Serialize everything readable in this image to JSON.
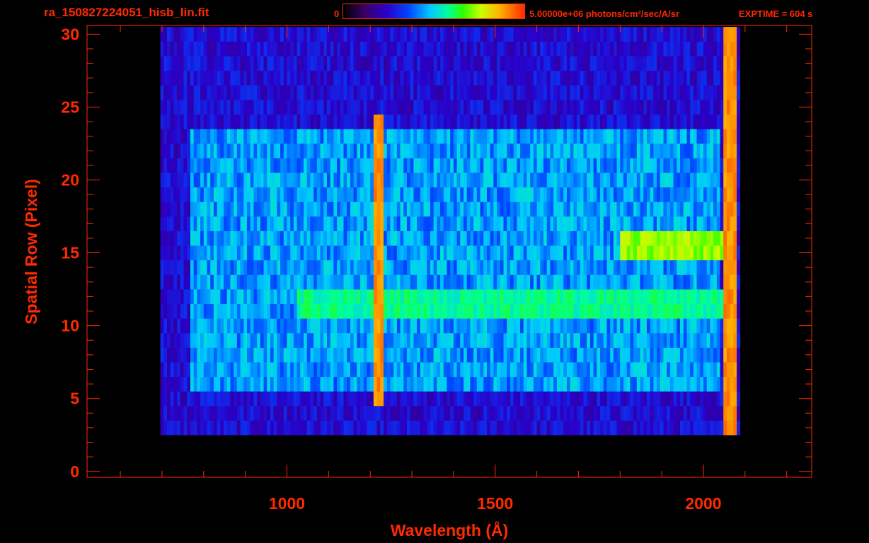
{
  "header": {
    "file_title": "ra_150827224051_hisb_lin.fit",
    "colorbar_min": "0",
    "colorbar_max": "5.00000e+06 photons/cm²/sec/A/sr",
    "exptime": "EXPTIME = 604 s"
  },
  "colors": {
    "axis": "#ff2a00",
    "background": "#000000",
    "colormap": [
      "#000000",
      "#3a0066",
      "#2a00c8",
      "#0044ff",
      "#00c8ff",
      "#00ff9a",
      "#2aff00",
      "#c8ff00",
      "#ffb400",
      "#ff2a00"
    ]
  },
  "chart_data": {
    "type": "heatmap",
    "title": "ra_150827224051_hisb_lin.fit",
    "xlabel": "Wavelength (Å)",
    "ylabel": "Spatial Row (Pixel)",
    "xlim": [
      520,
      2260
    ],
    "ylim": [
      -0.4,
      30.6
    ],
    "x_ticks": [
      1000,
      1500,
      2000
    ],
    "y_ticks": [
      0,
      5,
      10,
      15,
      20,
      25,
      30
    ],
    "x_minor_step": 100,
    "y_minor_step": 1,
    "colorbar": {
      "min": 0,
      "max": 5000000,
      "units": "photons/cm²/sec/A/sr"
    },
    "intensity_scale": "fraction of colorbar max",
    "detector_extent": {
      "x_range": [
        690,
        2060
      ],
      "rows": [
        3,
        30
      ]
    },
    "features": [
      {
        "name": "Lyman-alpha emission line",
        "wavelength": 1216,
        "rows": [
          5,
          24
        ],
        "level": 0.95
      },
      {
        "name": "continuum band",
        "wavelength_range": [
          1020,
          2060
        ],
        "rows": [
          11,
          12
        ],
        "level": 0.62
      },
      {
        "name": "long-wavelength emission band",
        "wavelength_range": [
          1800,
          2060
        ],
        "rows": [
          15,
          16
        ],
        "level": 0.8
      },
      {
        "name": "detector edge",
        "wavelength": 2060,
        "rows": [
          1,
          30
        ],
        "level": 0.95
      }
    ]
  }
}
